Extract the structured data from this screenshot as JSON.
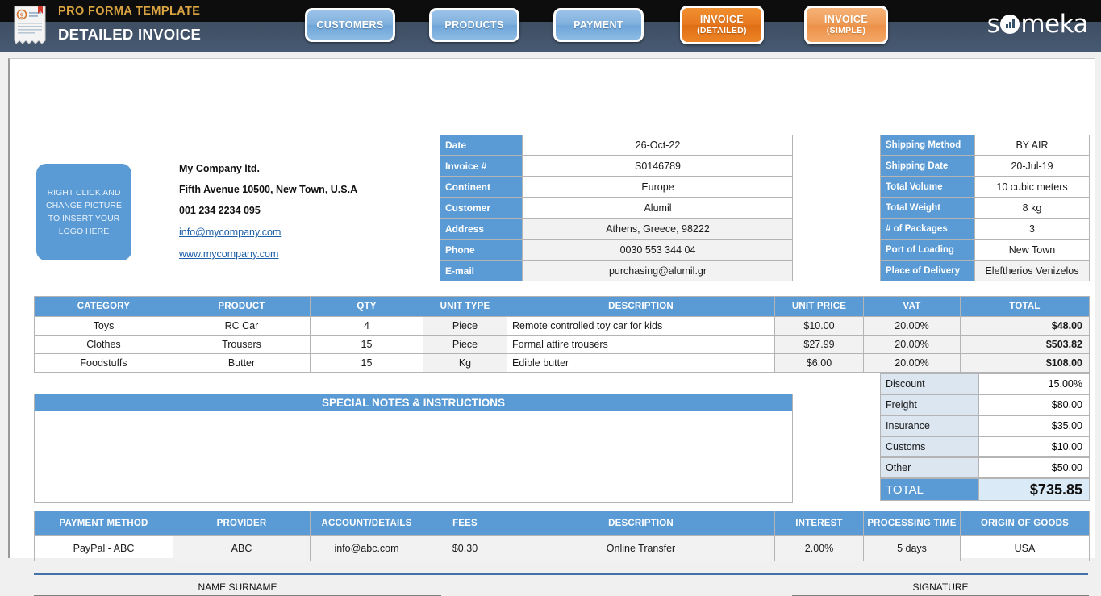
{
  "header": {
    "icon": "receipt-invoice-icon",
    "subtitle": "PRO FORMA TEMPLATE",
    "title": "DETAILED INVOICE",
    "brand": {
      "before": "s",
      "after": "meka"
    },
    "nav": [
      {
        "line1": "CUSTOMERS",
        "line2": ""
      },
      {
        "line1": "PRODUCTS",
        "line2": ""
      },
      {
        "line1": "PAYMENT",
        "line2": ""
      },
      {
        "line1": "INVOICE",
        "line2": "(DETAILED)"
      },
      {
        "line1": "INVOICE",
        "line2": "(SIMPLE)"
      }
    ]
  },
  "logo_placeholder": "RIGHT CLICK AND CHANGE PICTURE TO INSERT YOUR LOGO HERE",
  "company": {
    "name": "My Company ltd.",
    "address": "Fifth Avenue 10500, New Town, U.S.A",
    "phone": "001 234 2234 095",
    "email": "info@mycompany.com",
    "website": "www.mycompany.com"
  },
  "invoice_info": [
    {
      "label": "Date",
      "value": "26-Oct-22"
    },
    {
      "label": "Invoice #",
      "value": "S0146789"
    },
    {
      "label": "Continent",
      "value": "Europe"
    },
    {
      "label": "Customer",
      "value": "Alumil"
    },
    {
      "label": "Address",
      "value": "Athens, Greece, 98222"
    },
    {
      "label": "Phone",
      "value": "0030 553 344 04"
    },
    {
      "label": "E-mail",
      "value": "purchasing@alumil.gr"
    }
  ],
  "shipping_info": [
    {
      "label": "Shipping Method",
      "value": "BY AIR"
    },
    {
      "label": "Shipping Date",
      "value": "20-Jul-19"
    },
    {
      "label": "Total Volume",
      "value": "10 cubic meters"
    },
    {
      "label": "Total Weight",
      "value": "8 kg"
    },
    {
      "label": "# of Packages",
      "value": "3"
    },
    {
      "label": "Port of Loading",
      "value": "New Town"
    },
    {
      "label": "Place of Delivery",
      "value": "Eleftherios Venizelos"
    }
  ],
  "items_table": {
    "headers": [
      "CATEGORY",
      "PRODUCT",
      "QTY",
      "UNIT TYPE",
      "DESCRIPTION",
      "UNIT PRICE",
      "VAT",
      "TOTAL"
    ],
    "rows": [
      {
        "category": "Toys",
        "product": "RC Car",
        "qty": "4",
        "unit_type": "Piece",
        "description": "Remote controlled toy car for kids",
        "unit_price": "$10.00",
        "vat": "20.00%",
        "total": "$48.00"
      },
      {
        "category": "Clothes",
        "product": "Trousers",
        "qty": "15",
        "unit_type": "Piece",
        "description": "Formal attire trousers",
        "unit_price": "$27.99",
        "vat": "20.00%",
        "total": "$503.82"
      },
      {
        "category": "Foodstuffs",
        "product": "Butter",
        "qty": "15",
        "unit_type": "Kg",
        "description": "Edible butter",
        "unit_price": "$6.00",
        "vat": "20.00%",
        "total": "$108.00"
      }
    ]
  },
  "notes": {
    "title": "SPECIAL NOTES & INSTRUCTIONS",
    "body": ""
  },
  "summary": {
    "rows": [
      {
        "label": "Discount",
        "value": "15.00%"
      },
      {
        "label": "Freight",
        "value": "$80.00"
      },
      {
        "label": "Insurance",
        "value": "$35.00"
      },
      {
        "label": "Customs",
        "value": "$10.00"
      },
      {
        "label": "Other",
        "value": "$50.00"
      }
    ],
    "total_label": "TOTAL",
    "total_value": "$735.85"
  },
  "payment_table": {
    "headers": [
      "PAYMENT METHOD",
      "PROVIDER",
      "ACCOUNT/DETAILS",
      "FEES",
      "DESCRIPTION",
      "INTEREST",
      "PROCESSING TIME",
      "ORIGIN OF GOODS"
    ],
    "rows": [
      {
        "method": "PayPal - ABC",
        "provider": "ABC",
        "account": "info@abc.com",
        "fees": "$0.30",
        "description": "Online Transfer",
        "interest": "2.00%",
        "processing_time": "5 days",
        "origin": "USA"
      }
    ]
  },
  "footer": {
    "name_label": "NAME SURNAME",
    "signature_label": "SIGNATURE"
  },
  "colors": {
    "accent_blue": "#5b9bd5",
    "header_dark": "#0d0d0d",
    "header_slate": "#475a72",
    "gold": "#d9a441",
    "orange_active": "#e87820",
    "orange_inactive": "#ef9a55",
    "link": "#1d5fa8",
    "summary_label_bg": "#dce6f1",
    "total_value_bg": "#dbeaf7",
    "shaded_cell": "#f2f2f2"
  }
}
